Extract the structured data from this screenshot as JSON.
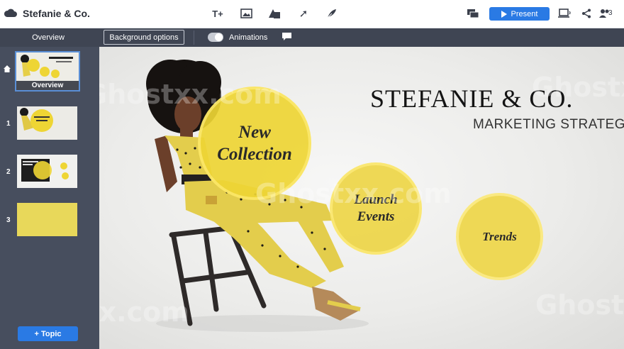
{
  "app": {
    "title": "Stefanie & Co."
  },
  "toolbar": {
    "tools": [
      {
        "icon": "text-icon",
        "glyph": "T+"
      },
      {
        "icon": "image-icon"
      },
      {
        "icon": "shapes-icon"
      },
      {
        "icon": "arrow-icon",
        "glyph": "➚"
      },
      {
        "icon": "draw-icon"
      }
    ],
    "present_label": "Present",
    "collaborators_count": "3"
  },
  "subbar": {
    "overview_label": "Overview",
    "background_options_label": "Background options",
    "animations_label": "Animations"
  },
  "sidebar": {
    "overview_thumb_label": "Overview",
    "slides": [
      {
        "number": "1"
      },
      {
        "number": "2"
      },
      {
        "number": "3"
      }
    ],
    "add_topic_label": "+ Topic"
  },
  "canvas": {
    "title": "STEFANIE & CO.",
    "subtitle": "MARKETING STRATEGY",
    "topics": [
      {
        "label_line1": "New",
        "label_line2": "Collection"
      },
      {
        "label_line1": "Launch",
        "label_line2": "Events"
      },
      {
        "label_line1": "Trends"
      }
    ],
    "watermark": "Ghostxx.com"
  },
  "colors": {
    "accent": "#2a7ae4",
    "topic_yellow": "#eed534",
    "sidebar_bg": "#474e5e"
  }
}
